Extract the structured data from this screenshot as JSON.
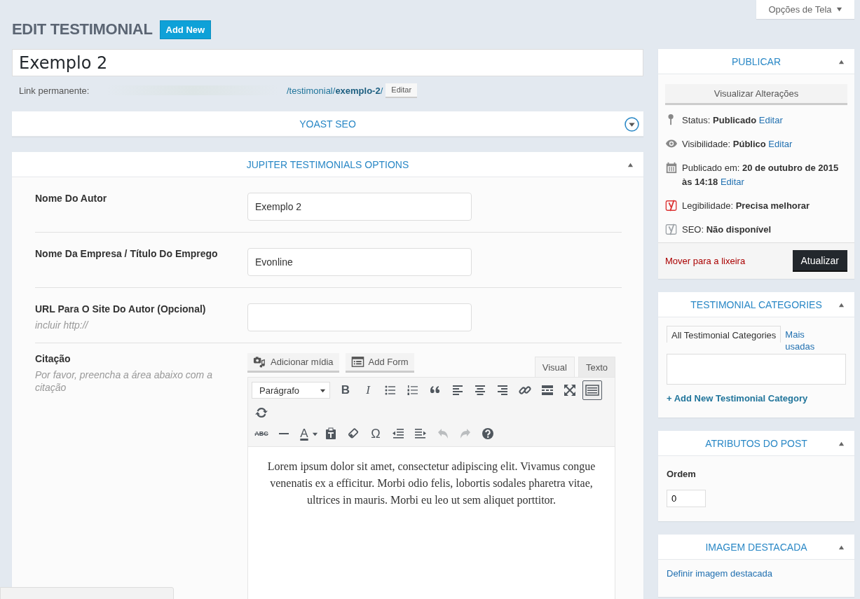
{
  "screen_options": {
    "label": "Opções de Tela"
  },
  "page_title": "EDIT TESTIMONIAL",
  "add_new": "Add New",
  "post_title": {
    "value": "Exemplo 2"
  },
  "permalink": {
    "label": "Link permanente:",
    "url": "/testimonial/**exemplo-2**/",
    "edit": "Editar"
  },
  "main_boxes": [
    {
      "kind": "seo",
      "title": "YOAST SEO",
      "expanded": false
    },
    {
      "kind": "options",
      "title": "JUPITER TESTIMONIALS OPTIONS",
      "expanded": true,
      "fields": [
        {
          "kind": "text",
          "label": "Nome Do Autor",
          "value": "Exemplo 2"
        },
        {
          "kind": "text",
          "label": "Nome Da Empresa / Título Do Emprego",
          "value": "Evonline"
        },
        {
          "kind": "text",
          "label": "URL Para O Site Do Autor (Opcional)",
          "hint": "incluir http://"
        },
        {
          "kind": "editor",
          "label": "Citação",
          "hint": "Por favor, preencha a área abaixo com a citação"
        }
      ]
    }
  ],
  "editor": {
    "media_buttons": [
      {
        "kind": "media",
        "label": "Adicionar mídia"
      },
      {
        "kind": "form",
        "label": "Add Form"
      }
    ],
    "tabs": [
      {
        "label": "Visual",
        "selected": true
      },
      {
        "label": "Texto",
        "selected": false
      }
    ],
    "format": "Parágrafo",
    "toolbar_rows": [
      [
        {
          "kind": "bold",
          "text": "B",
          "pressed": false,
          "disabled": false
        },
        {
          "kind": "italic",
          "text": "I",
          "pressed": false,
          "disabled": false
        },
        {
          "kind": "bullet-list",
          "pressed": false,
          "disabled": false
        },
        {
          "kind": "numbered-list",
          "pressed": false,
          "disabled": false
        },
        {
          "kind": "quote",
          "pressed": false,
          "disabled": false
        },
        {
          "kind": "align-left",
          "pressed": false,
          "disabled": false
        },
        {
          "kind": "align-center",
          "pressed": false,
          "disabled": false
        },
        {
          "kind": "align-right",
          "pressed": false,
          "disabled": false
        },
        {
          "kind": "link",
          "pressed": false,
          "disabled": false
        },
        {
          "kind": "read-more",
          "pressed": false,
          "disabled": false
        },
        {
          "kind": "fullscreen",
          "pressed": false,
          "disabled": false
        },
        {
          "kind": "toolbar-toggle",
          "pressed": true,
          "disabled": false
        },
        {
          "kind": "refresh",
          "pressed": false,
          "disabled": false
        }
      ],
      [
        {
          "kind": "strike",
          "text": "ABC",
          "pressed": false,
          "disabled": false
        },
        {
          "kind": "hr",
          "pressed": false,
          "disabled": false
        },
        {
          "kind": "text-color",
          "text": "A",
          "pressed": false,
          "disabled": false
        },
        {
          "kind": "paste",
          "pressed": false,
          "disabled": false
        },
        {
          "kind": "eraser",
          "pressed": false,
          "disabled": false
        },
        {
          "kind": "symbol",
          "text": "Ω",
          "pressed": false,
          "disabled": false
        },
        {
          "kind": "outdent",
          "pressed": false,
          "disabled": false
        },
        {
          "kind": "indent",
          "pressed": false,
          "disabled": false
        },
        {
          "kind": "undo",
          "pressed": false,
          "disabled": true
        },
        {
          "kind": "redo",
          "pressed": false,
          "disabled": true
        },
        {
          "kind": "help",
          "pressed": false,
          "disabled": false
        }
      ]
    ],
    "content": "Lorem ipsum dolor sit amet, consectetur adipiscing elit. Vivamus congue venenatis ex a efficitur. Morbi odio felis, lobortis sodales pharetra vitae, ultrices in mauris. Morbi eu leo ut sem aliquet porttitor."
  },
  "side_boxes": [
    {
      "kind": "publish",
      "title": "PUBLICAR",
      "expanded": true,
      "preview": "Visualizar Alterações",
      "rows": [
        {
          "kind": "pin",
          "label": "Status:",
          "value": "Publicado",
          "link": "Editar"
        },
        {
          "kind": "eye",
          "label": "Visibilidade:",
          "value": "Público",
          "link": "Editar"
        },
        {
          "kind": "calendar",
          "label": "Publicado em:",
          "value": "20 de outubro de 2015 às 14:18",
          "link": "Editar"
        },
        {
          "kind": "yoast",
          "color": "#dc3232",
          "label": "Legibilidade:",
          "value": "Precisa melhorar"
        },
        {
          "kind": "yoast",
          "color": "#a0a5aa",
          "label": "SEO:",
          "value": "Não disponível"
        }
      ],
      "trash": "Mover para a lixeira",
      "update": "Atualizar"
    },
    {
      "kind": "categories",
      "title": "TESTIMONIAL CATEGORIES",
      "expanded": true,
      "tabs": [
        {
          "label": "All Testimonial Categories",
          "selected": true
        },
        {
          "label": "Mais usadas",
          "selected": false
        }
      ],
      "add": "+ Add New Testimonial Category"
    },
    {
      "kind": "attributes",
      "title": "ATRIBUTOS DO POST",
      "expanded": true,
      "label": "Ordem",
      "value": "0"
    },
    {
      "kind": "image",
      "title": "IMAGEM DESTACADA",
      "expanded": true,
      "link": "Definir imagem destacada"
    }
  ]
}
